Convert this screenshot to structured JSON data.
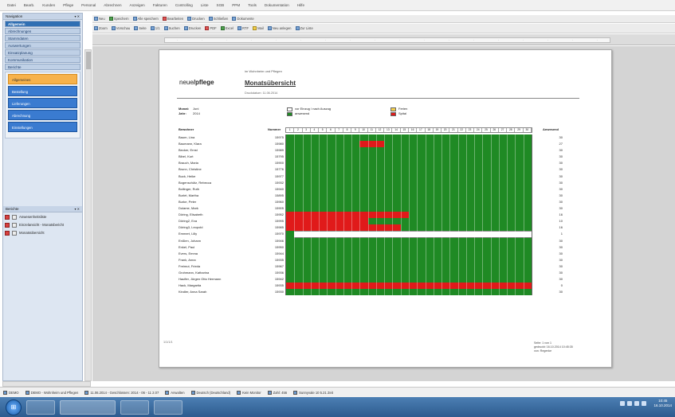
{
  "menubar": {
    "items": [
      "Datei",
      "Bearb.",
      "Kunden",
      "Pflege",
      "Personal",
      "Abrechnen",
      "Anzeigen",
      "Fakturen",
      "Controlling",
      "Liste",
      "SGB",
      "PPM",
      "Tools",
      "Dokumentation",
      "Hilfe"
    ]
  },
  "leftpanel": {
    "header": "Navigation",
    "nav_items": [
      "Allgemein",
      "Abrechnungen",
      "Stammdaten",
      "Auswertungen",
      "Einsatzplanung",
      "Kommunikation",
      "Berichte"
    ],
    "sub_items": [
      "Allgemeines",
      "Bestellung",
      "Lieferungen",
      "Abrechnung",
      "Einstellungen"
    ],
    "active_sub_index": 0
  },
  "lowerpanel": {
    "header": "Berichte",
    "items": [
      "Anwesenheitsliste",
      "Einzelansicht - Monatsbericht",
      "Monatsübersicht"
    ]
  },
  "toolbar1": {
    "buttons": [
      "Neu",
      "Speichern",
      "Alle speichern",
      "Bearbeiten",
      "Drucken",
      "Schließen",
      "Dokumente"
    ]
  },
  "toolbar2": {
    "buttons": [
      "Zoom",
      "Vorschau",
      "Seite",
      "1/1",
      "Suchen",
      "Drucken",
      "PDF",
      "Excel",
      "RTF",
      "Mail",
      "Neu anlegen",
      "Zur Liste"
    ]
  },
  "report": {
    "subtitle": "im Wohnheim und Pflegen",
    "logo_a": "neue",
    "logo_b": "pflege",
    "title": "Monatsübersicht",
    "printed": "Druckdatum: 11.06.2014",
    "meta": [
      {
        "key": "Monat:",
        "value": "Juni"
      },
      {
        "key": "Jahr:",
        "value": "2014"
      }
    ],
    "legend": [
      {
        "label": "vor Einzug / nach Auszug",
        "color": "#ffffff"
      },
      {
        "label": "anwesend",
        "color": "#1f8a24"
      },
      {
        "label": "Ferien",
        "color": "#f3cf4c"
      },
      {
        "label": "Spital",
        "color": "#e01a1a"
      }
    ],
    "col_name": "Bewohner",
    "col_number": "Nummer",
    "col_present": "Anwesend",
    "days": [
      "1",
      "2",
      "3",
      "4",
      "5",
      "6",
      "7",
      "8",
      "9",
      "10",
      "11",
      "12",
      "13",
      "14",
      "15",
      "16",
      "17",
      "18",
      "19",
      "20",
      "21",
      "22",
      "23",
      "24",
      "25",
      "26",
      "27",
      "28",
      "29",
      "30"
    ],
    "rows": [
      {
        "name": "Baum, Lina",
        "number": "15975",
        "present": "30",
        "red": []
      },
      {
        "name": "Baumann, Klara",
        "number": "15980",
        "present": "27",
        "red": [
          [
            9,
            12
          ]
        ]
      },
      {
        "name": "Becker, Ernst",
        "number": "15989",
        "present": "30",
        "red": []
      },
      {
        "name": "Bibel, Kurt",
        "number": "15795",
        "present": "30",
        "red": []
      },
      {
        "name": "Brauch, Maria",
        "number": "15900",
        "present": "30",
        "red": []
      },
      {
        "name": "Brunn, Christine",
        "number": "15776",
        "present": "30",
        "red": []
      },
      {
        "name": "Buck, Heike",
        "number": "15977",
        "present": "30",
        "red": []
      },
      {
        "name": "Bogenschütz, Rebecca",
        "number": "15932",
        "present": "30",
        "red": []
      },
      {
        "name": "Bollinger, Ruth",
        "number": "15940",
        "present": "30",
        "red": []
      },
      {
        "name": "Burlet, Martha",
        "number": "15895",
        "present": "30",
        "red": []
      },
      {
        "name": "Burke, Peter",
        "number": "15960",
        "present": "30",
        "red": []
      },
      {
        "name": "Dolame, Mark",
        "number": "15905",
        "present": "30",
        "red": []
      },
      {
        "name": "Döring, Elisabeth",
        "number": "15952",
        "present": "16",
        "red": [
          [
            0,
            15
          ]
        ]
      },
      {
        "name": "Döring2, Eva",
        "number": "15995",
        "present": "10",
        "red": [
          [
            0,
            10
          ]
        ]
      },
      {
        "name": "Döring3, Leopold",
        "number": "15985",
        "present": "16",
        "red": [
          [
            0,
            14
          ]
        ]
      },
      {
        "name": "Emmert, Lilly",
        "number": "15970",
        "present": "1",
        "red": [],
        "green_only": [
          0,
          1
        ]
      },
      {
        "name": "Enßlen, Johann",
        "number": "15946",
        "present": "30",
        "red": []
      },
      {
        "name": "Enkel, Paul",
        "number": "15950",
        "present": "30",
        "red": []
      },
      {
        "name": "Evers, Emma",
        "number": "15944",
        "present": "30",
        "red": []
      },
      {
        "name": "Frank, Anna",
        "number": "15935",
        "present": "30",
        "red": []
      },
      {
        "name": "Freimut, Frieda",
        "number": "15967",
        "present": "30",
        "red": []
      },
      {
        "name": "Grohmann, Katharina",
        "number": "15936",
        "present": "30",
        "red": []
      },
      {
        "name": "Haufler, Jürgen Otto Hermann",
        "number": "15942",
        "present": "30",
        "red": []
      },
      {
        "name": "Hack, Margarita",
        "number": "15935",
        "present": "0",
        "red": [
          [
            0,
            30
          ]
        ]
      },
      {
        "name": "Kindler, Anna Sarah",
        "number": "15930",
        "present": "30",
        "red": []
      }
    ],
    "footer_left": "1/1/1/1",
    "footer_right": [
      "Seite: 1 von 1",
      "gedruckt: 16.10.2014 10:45:35",
      "von: Regenke"
    ]
  },
  "statusbar": {
    "items": [
      "DEMO",
      "DEMO - Wohnheim und Pflegen",
      "11.06.2014 - Geschlossen: 2014 - 06 - 11 2.07",
      "Anwalten",
      "Deutsch (Deutschland)",
      "Kein Monitor",
      "Zahl: 456",
      "Sunnyvale 10 5.21 Zeit"
    ]
  },
  "taskbar": {
    "clock_time": "10:45",
    "clock_date": "16.10.2014"
  }
}
